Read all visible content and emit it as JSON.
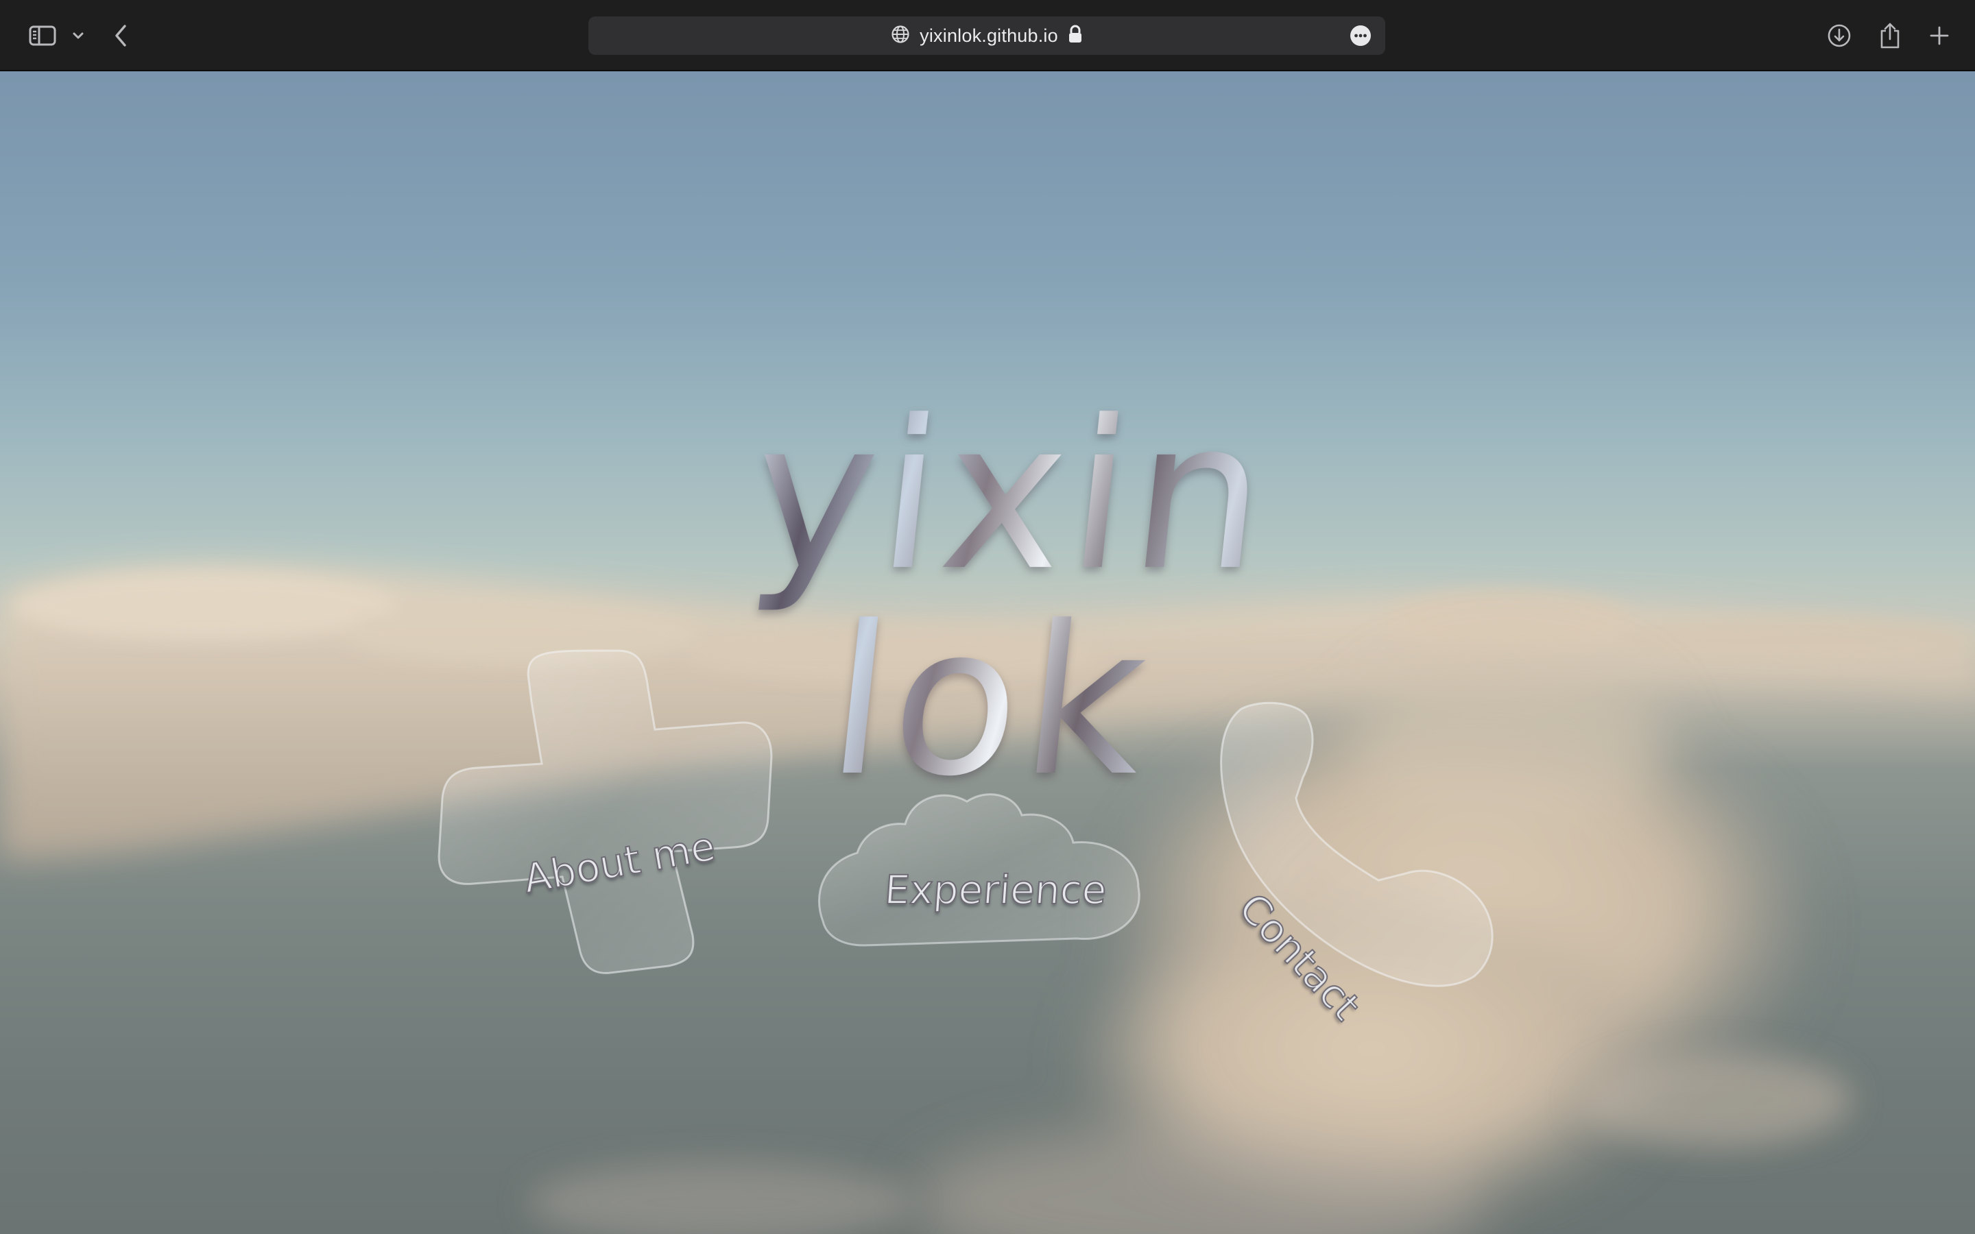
{
  "browser": {
    "url": "yixinlok.github.io",
    "icons": {
      "sidebar": "sidebar-icon",
      "sidebar_menu": "chevron-down-icon",
      "back": "chevron-left-icon",
      "site": "globe-icon",
      "secure": "lock-icon",
      "more": "ellipsis-circle-icon",
      "downloads": "download-icon",
      "share": "share-icon",
      "new_tab": "plus-icon"
    }
  },
  "page": {
    "title": "yixin lok",
    "nav": {
      "about": "About me",
      "experience": "Experience",
      "contact": "Contact"
    },
    "colors": {
      "sky_top": "#7a95ad",
      "horizon": "#c7c9bd",
      "sea": "#6b7472",
      "cloud": "#d8c8b2"
    }
  }
}
